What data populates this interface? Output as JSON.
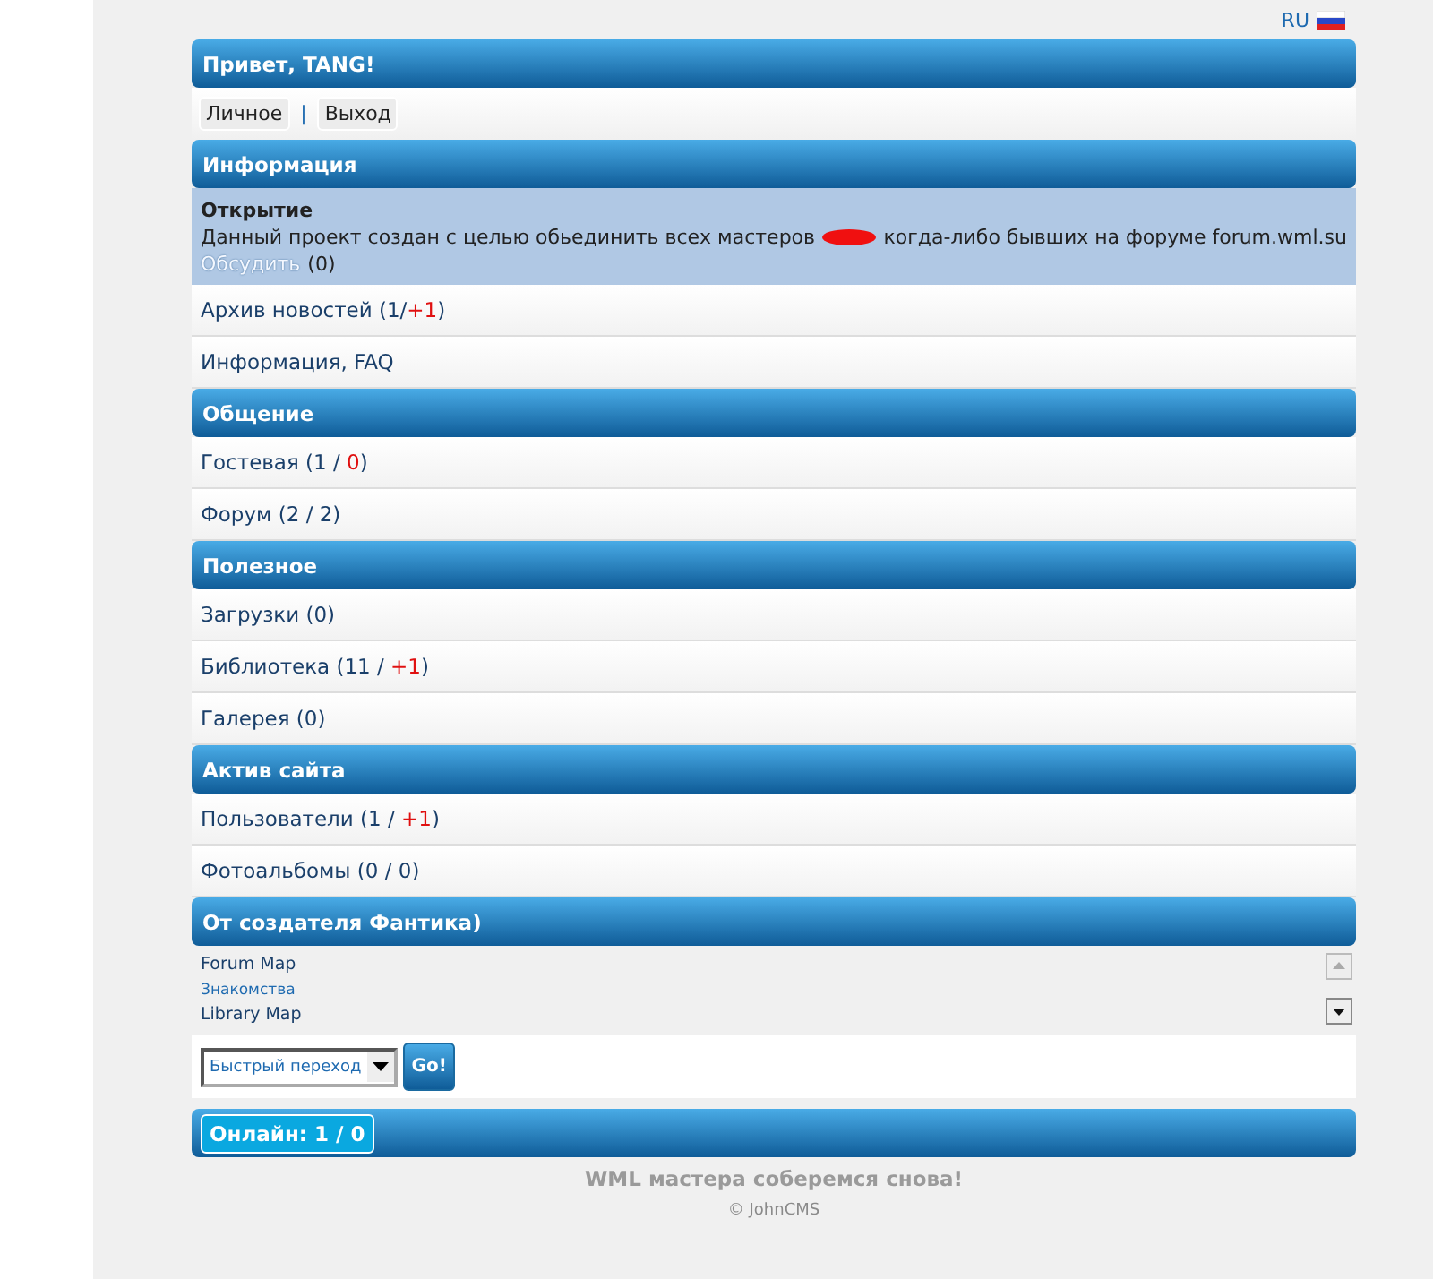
{
  "language": {
    "label": "RU"
  },
  "greeting": {
    "title": "Привет, TANG!",
    "buttons": [
      "Личное",
      "Выход"
    ],
    "separator": "|"
  },
  "sections": [
    {
      "title": "Информация",
      "news": {
        "title": "Открытие",
        "text_before": "Данный проект создан с целью обьединить всех мастеров",
        "text_after": "когда-либо бывших на форуме forum.wml.su",
        "link": "Обсудить",
        "count": "(0)"
      },
      "items": [
        {
          "parts": [
            {
              "text": "Архив новостей (1/",
              "highlight": false
            },
            {
              "text": "+1",
              "highlight": true
            },
            {
              "text": ")",
              "highlight": false
            }
          ]
        },
        {
          "parts": [
            {
              "text": "Информация, FAQ",
              "highlight": false
            }
          ]
        }
      ]
    },
    {
      "title": "Общение",
      "items": [
        {
          "parts": [
            {
              "text": "Гостевая (1 / ",
              "highlight": false
            },
            {
              "text": "0",
              "highlight": true
            },
            {
              "text": ")",
              "highlight": false
            }
          ]
        },
        {
          "parts": [
            {
              "text": "Форум (2 / 2)",
              "highlight": false
            }
          ]
        }
      ]
    },
    {
      "title": "Полезное",
      "items": [
        {
          "parts": [
            {
              "text": "Загрузки (0)",
              "highlight": false
            }
          ]
        },
        {
          "parts": [
            {
              "text": "Библиотека (11 / ",
              "highlight": false
            },
            {
              "text": "+1",
              "highlight": true
            },
            {
              "text": ")",
              "highlight": false
            }
          ]
        },
        {
          "parts": [
            {
              "text": "Галерея (0)",
              "highlight": false
            }
          ]
        }
      ]
    },
    {
      "title": "Актив сайта",
      "items": [
        {
          "parts": [
            {
              "text": "Пользователи (1 / ",
              "highlight": false
            },
            {
              "text": "+1",
              "highlight": true
            },
            {
              "text": ")",
              "highlight": false
            }
          ]
        },
        {
          "parts": [
            {
              "text": "Фотоальбомы (0 / 0)",
              "highlight": false
            }
          ]
        }
      ]
    },
    {
      "title": "От создателя Фантика)",
      "links": [
        {
          "text": "Forum Map",
          "kind": "bold"
        },
        {
          "text": "Знакомства",
          "kind": "small"
        },
        {
          "text": "Library Map",
          "kind": "bold"
        }
      ],
      "jump": {
        "placeholder": "Быстрый переход",
        "button": "Go!"
      }
    }
  ],
  "online": "Онлайн: 1 / 0",
  "footer": {
    "slogan": "WML мастера соберемся снова!",
    "copyright": "© JohnCMS"
  }
}
